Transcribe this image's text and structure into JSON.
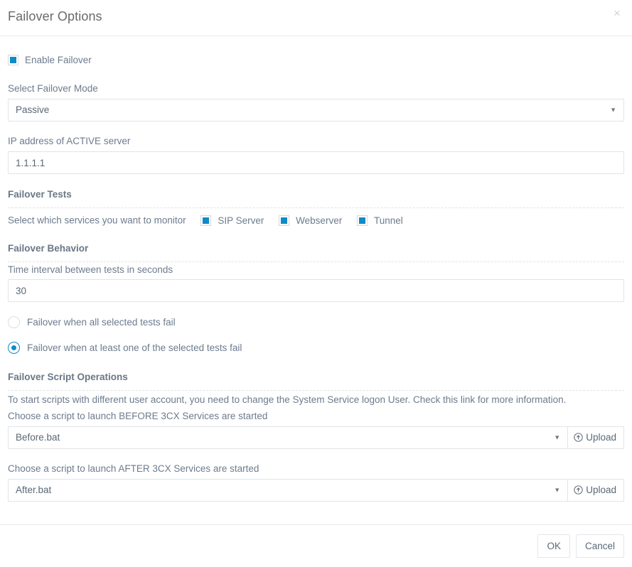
{
  "dialog": {
    "title": "Failover Options",
    "close_label": "×"
  },
  "enable": {
    "label": "Enable Failover",
    "checked": true
  },
  "mode": {
    "label": "Select Failover Mode",
    "value": "Passive",
    "options": [
      "Passive"
    ],
    "caret": "▼"
  },
  "active_ip": {
    "label": "IP address of ACTIVE server",
    "value": "1.1.1.1"
  },
  "tests": {
    "title": "Failover Tests",
    "prompt": "Select which services you want to monitor",
    "items": [
      {
        "label": "SIP Server",
        "checked": true
      },
      {
        "label": "Webserver",
        "checked": true
      },
      {
        "label": "Tunnel",
        "checked": true
      }
    ]
  },
  "behavior": {
    "title": "Failover Behavior",
    "interval_label": "Time interval between tests in seconds",
    "interval_value": "30",
    "radios": [
      {
        "label": "Failover when all selected tests fail",
        "selected": false
      },
      {
        "label": "Failover when at least one of the selected tests fail",
        "selected": true
      }
    ]
  },
  "scripts": {
    "title": "Failover Script Operations",
    "note": "To start scripts with different user account, you need to change the System Service logon User. Check this link for more information.",
    "before_label": "Choose a script to launch BEFORE 3CX Services are started",
    "before_value": "Before.bat",
    "after_label": "Choose a script to launch AFTER 3CX Services are started",
    "after_value": "After.bat",
    "upload_label": "Upload",
    "caret": "▼"
  },
  "footer": {
    "ok": "OK",
    "cancel": "Cancel"
  },
  "colors": {
    "accent": "#0f8bc6",
    "text": "#6d7b8d",
    "border": "#e0e4e8"
  }
}
